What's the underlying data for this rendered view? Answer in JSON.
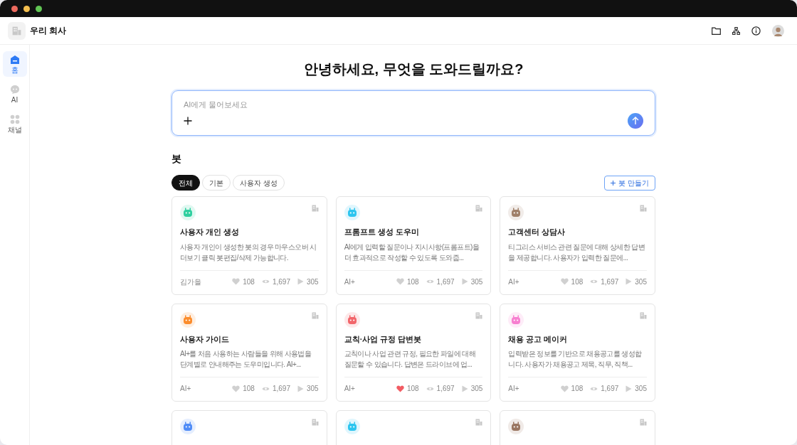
{
  "header": {
    "company": "우리 회사"
  },
  "sidebar": {
    "items": [
      {
        "kind": "home",
        "label": "홈",
        "selected": true
      },
      {
        "kind": "chat",
        "label": "AI",
        "selected": false
      },
      {
        "kind": "apps",
        "label": "채널",
        "selected": false
      }
    ]
  },
  "greeting": "안녕하세요, 무엇을 도와드릴까요?",
  "prompt": {
    "placeholder": "AI에게 물어보세요"
  },
  "bots": {
    "title": "봇",
    "create_button": "봇 만들기",
    "tabs": [
      {
        "label": "전체",
        "selected": true
      },
      {
        "label": "기본",
        "selected": false
      },
      {
        "label": "사용자 생성",
        "selected": false
      }
    ],
    "cards": [
      {
        "color": "#2ecf9f",
        "title": "사용자 개인 생성",
        "description": "사용자 개인이 생성한 봇의 경우 마우스오버 시 더보기 클릭 봇편집/삭제 가능합니다.",
        "author": "김가을",
        "likes": "108",
        "liked": false,
        "views": "1,697",
        "runs": "305"
      },
      {
        "color": "#2cc5ef",
        "title": "프롬프트 생성 도우미",
        "description": "AI에게 입력할 질문이나 지시사항(프롬프트)을 더 효과적으로 작성할 수 있도록 도와줍...",
        "author": "AI+",
        "likes": "108",
        "liked": false,
        "views": "1,697",
        "runs": "305"
      },
      {
        "color": "#a0806a",
        "title": "고객센터 상담사",
        "description": "티그리스 서비스 관련 질문에 대해 상세한 답변을 제공합니다. 사용자가 입력한 질문에...",
        "author": "AI+",
        "likes": "108",
        "liked": false,
        "views": "1,697",
        "runs": "305"
      },
      {
        "color": "#fb8c2c",
        "title": "사용자 가이드",
        "description": "AI+를 처음 사용하는 사람들을 위해 사용법을 단계별로 안내해주는 도우미입니다. AI+...",
        "author": "AI+",
        "likes": "108",
        "liked": false,
        "views": "1,697",
        "runs": "305"
      },
      {
        "color": "#f2656a",
        "title": "교칙·사업 규정 답변봇",
        "description": "교칙이나 사업 관련 규정, 필요한 파일에 대해 질문할 수 있습니다. 답변은 드라이브에 업...",
        "author": "AI+",
        "likes": "108",
        "liked": true,
        "views": "1,697",
        "runs": "305"
      },
      {
        "color": "#f77fd0",
        "title": "채용 공고 메이커",
        "description": "입력받은 정보를 기반으로 채용공고를 생성합니다. 사용자가 채용공고 제목, 직무, 직책...",
        "author": "AI+",
        "likes": "108",
        "liked": false,
        "views": "1,697",
        "runs": "305"
      },
      {
        "color": "#4f8cf7"
      },
      {
        "color": "#2cc5ef"
      },
      {
        "color": "#9a7560"
      }
    ]
  }
}
